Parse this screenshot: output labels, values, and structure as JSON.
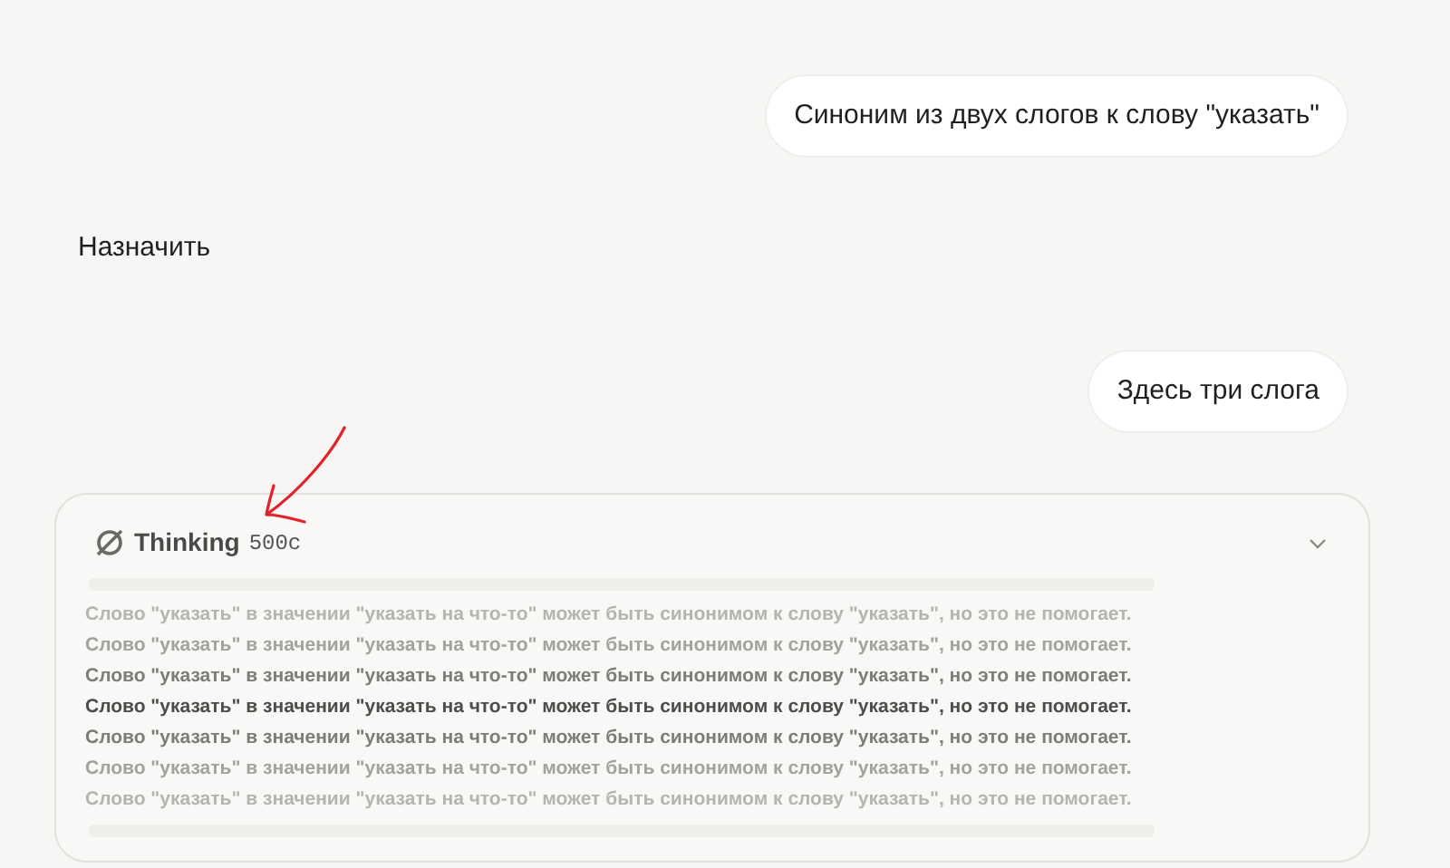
{
  "messages": [
    {
      "kind": "user",
      "text": "Синоним из двух слогов к слову \"указать\""
    },
    {
      "kind": "assistant",
      "text": "Назначить"
    },
    {
      "kind": "user",
      "text": "Здесь три слога"
    }
  ],
  "thinking": {
    "label": "Thinking",
    "duration": "500c",
    "expanded": true,
    "lines": [
      {
        "kind": "light",
        "text": "Слово \"указать\" в значении \"указать на что-то\" может быть синонимом к слову \"указать\", но это не помогает."
      },
      {
        "kind": "medium",
        "text": "Слово \"указать\" в значении \"указать на что-то\" может быть синонимом к слову \"указать\", но это не помогает."
      },
      {
        "kind": "dark",
        "text": "Слово \"указать\" в значении \"указать на что-то\" может быть синонимом к слову \"указать\", но это не помогает."
      },
      {
        "kind": "darkest",
        "text": "Слово \"указать\" в значении \"указать на что-то\" может быть синонимом к слову \"указать\", но это не помогает."
      },
      {
        "kind": "dark",
        "text": "Слово \"указать\" в значении \"указать на что-то\" может быть синонимом к слову \"указать\", но это не помогает."
      },
      {
        "kind": "medium",
        "text": "Слово \"указать\" в значении \"указать на что-то\" может быть синонимом к слову \"указать\", но это не помогает."
      },
      {
        "kind": "light",
        "text": "Слово \"указать\" в значении \"указать на что-то\" может быть синонимом к слову \"указать\", но это не помогает."
      }
    ]
  }
}
